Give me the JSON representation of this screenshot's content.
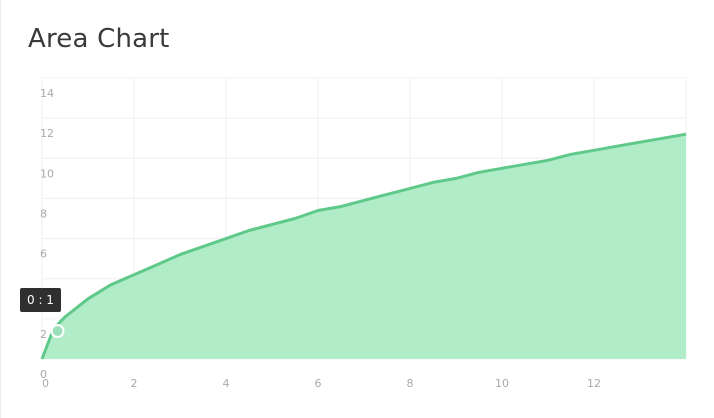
{
  "title": "Area Chart",
  "tooltip": "0 : 1",
  "colors": {
    "line": "#5fc989",
    "area": "#b1ecc9",
    "grid": "#f0f0f0",
    "tick": "#a9a9a9",
    "tooltip_bg": "#2f2f2f"
  },
  "chart_data": {
    "type": "area",
    "title": "Area Chart",
    "xlabel": "",
    "ylabel": "",
    "xlim": [
      0,
      14
    ],
    "ylim": [
      0,
      14
    ],
    "x_ticks": [
      0,
      2,
      4,
      6,
      8,
      10,
      12
    ],
    "y_ticks": [
      0,
      2,
      4,
      6,
      8,
      10,
      12,
      14
    ],
    "grid": true,
    "series": [
      {
        "x": [
          0,
          0.25,
          0.5,
          1,
          1.5,
          2,
          2.5,
          3,
          3.5,
          4,
          4.5,
          5,
          5.5,
          6,
          6.5,
          7,
          7.5,
          8,
          8.5,
          9,
          9.5,
          10,
          10.5,
          11,
          11.5,
          12,
          12.5,
          13,
          13.5,
          14
        ],
        "values": [
          0,
          1.5,
          2.1,
          3.0,
          3.7,
          4.2,
          4.7,
          5.2,
          5.6,
          6.0,
          6.4,
          6.7,
          7.0,
          7.4,
          7.6,
          7.9,
          8.2,
          8.5,
          8.8,
          9.0,
          9.3,
          9.5,
          9.7,
          9.9,
          10.2,
          10.4,
          10.6,
          10.8,
          11.0,
          11.2
        ]
      }
    ],
    "highlight_point": {
      "x": 0.25,
      "y": 1.5
    }
  }
}
